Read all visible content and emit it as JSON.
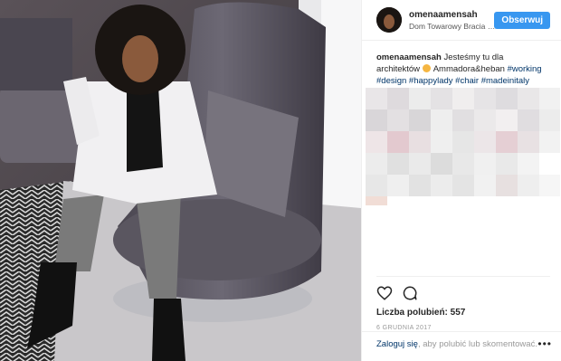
{
  "post": {
    "username": "omenaamensah",
    "location": "Dom Towarowy Bracia J...",
    "follow_label": "Obserwuj",
    "caption": {
      "username": "omenaamensah",
      "text_line1": "Jesteśmy tu dla architektów",
      "mention": "Ammadora&heban",
      "hashtags": [
        "#working",
        "#design",
        "#happylady",
        "#chair",
        "#madeinitaly"
      ]
    },
    "likes_label": "Liczba polubień:",
    "likes_count": "557",
    "date": "6 GRUDNIA 2017",
    "login_link": "Zaloguj się",
    "login_rest": ", aby polubić lub skomentować.",
    "more_label": "•••"
  },
  "icons": {
    "like": "heart-icon",
    "comment": "comment-bubble-icon",
    "more": "more-options-icon",
    "emoji": "heart-eyes-emoji-icon"
  },
  "colors": {
    "follow_button": "#3897f0",
    "link": "#003569",
    "muted": "#999999",
    "border": "#efefef"
  }
}
